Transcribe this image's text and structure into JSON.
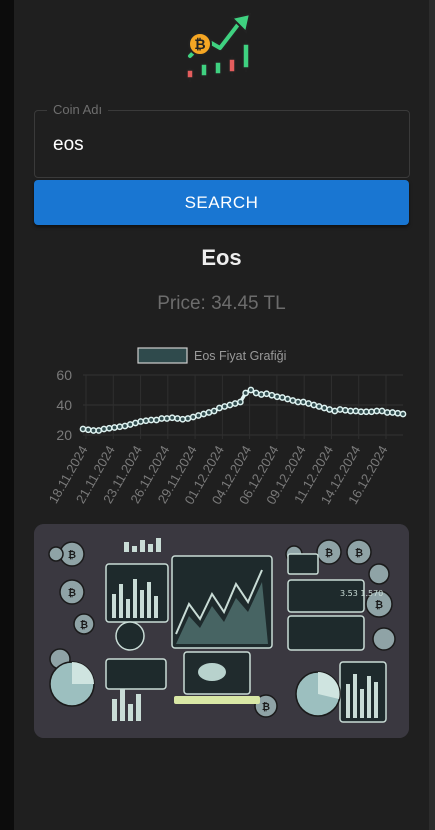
{
  "search": {
    "label": "Coin Adı",
    "value": "eos",
    "button_label": "SEARCH"
  },
  "result": {
    "coin_name": "Eos",
    "price_text": "Price: 34.45 TL"
  },
  "colors": {
    "accent": "#1976d2",
    "line": "#dff3f1",
    "legend_fill": "#2f4a4c"
  },
  "chart_data": {
    "type": "line",
    "legend": "Eos Fiyat Grafiği",
    "ylim": [
      20,
      60
    ],
    "yticks": [
      20,
      40,
      60
    ],
    "xticks": [
      "18.11.2024",
      "21.11.2024",
      "23.11.2024",
      "26.11.2024",
      "29.11.2024",
      "01.12.2024",
      "04.12.2024",
      "06.12.2024",
      "09.12.2024",
      "11.12.2024",
      "14.12.2024",
      "16.12.2024"
    ],
    "values": [
      24,
      23.5,
      23,
      23,
      24,
      24.5,
      25,
      25.5,
      26,
      27,
      28,
      29,
      29.5,
      30,
      30,
      31,
      31,
      31.5,
      31,
      30.5,
      31,
      32,
      33,
      34,
      35,
      36,
      38,
      39,
      40,
      41,
      42,
      48,
      50,
      48,
      47,
      47.5,
      46.5,
      45.5,
      45,
      44,
      43,
      42,
      42,
      41,
      40,
      39,
      38,
      37,
      36,
      37,
      36.5,
      36,
      36,
      35.5,
      35.5,
      35.5,
      36,
      36,
      35,
      35,
      34.5,
      34
    ]
  }
}
